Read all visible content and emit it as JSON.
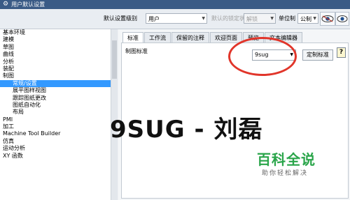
{
  "window": {
    "title": "用户默认设置"
  },
  "toolbar": {
    "level_label": "默认设置级别",
    "level_value": "用户",
    "lock_label": "默认的锁定状态",
    "lock_value": "解锁",
    "unit_label": "单位制",
    "unit_value": "公制"
  },
  "tree": {
    "items": [
      "基本环境",
      "建模",
      "草图",
      "曲线",
      "分析",
      "装配",
      "制图",
      "常规/设置",
      "展平图样视图",
      "跟踪图纸更改",
      "图纸自动化",
      "布局",
      "PMI",
      "加工",
      "Machine Tool Builder",
      "仿真",
      "运动分析",
      "XY 函数"
    ]
  },
  "tabs": [
    "标准",
    "工作流",
    "保留的注释",
    "欢迎页面",
    "预览",
    "文本编辑器"
  ],
  "content": {
    "field_label": "制图标准",
    "standard_value": "9sug",
    "custom_button": "定制标准",
    "help": "?"
  },
  "overlay": {
    "watermark": "9SUG - 刘磊",
    "brand_title": "百科全说",
    "brand_sub": "助你轻松解决"
  },
  "colors": {
    "titlebar": "#3a5b86",
    "selection": "#3399ff",
    "highlight_circle": "#e1352a",
    "brand": "#2aa54a"
  }
}
